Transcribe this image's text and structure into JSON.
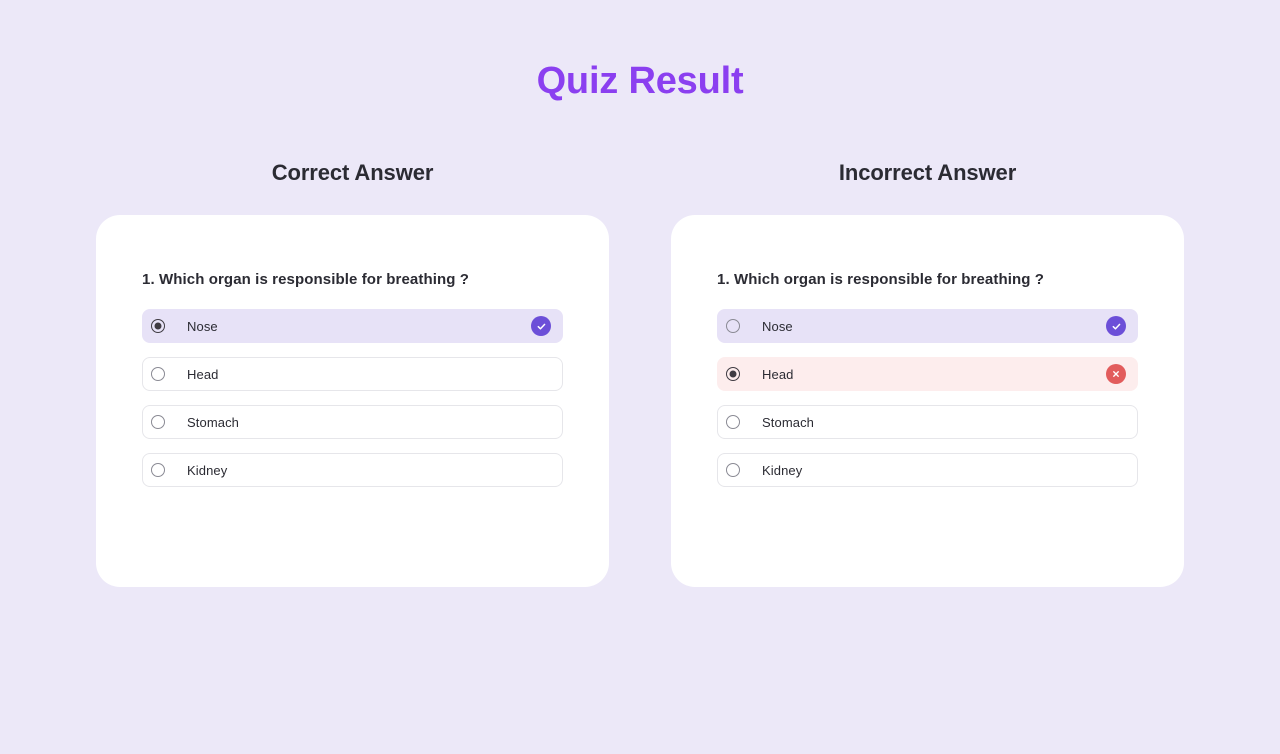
{
  "page": {
    "title": "Quiz Result",
    "title_color": "#8b3ff0",
    "background_color": "#ece8f8"
  },
  "colors": {
    "correct_badge": "#6c4fd8",
    "incorrect_badge": "#e25c5c",
    "correct_row_bg": "#e7e2f7",
    "incorrect_row_bg": "#fdeded",
    "card_bg": "#ffffff"
  },
  "columns": [
    {
      "heading": "Correct Answer",
      "card": {
        "question": "1. Which organ is responsible for breathing ?",
        "options": [
          {
            "label": "Nose",
            "selected": true,
            "state": "correct",
            "badge": "check-icon"
          },
          {
            "label": "Head",
            "selected": false,
            "state": "neutral",
            "badge": "none"
          },
          {
            "label": "Stomach",
            "selected": false,
            "state": "neutral",
            "badge": "none"
          },
          {
            "label": "Kidney",
            "selected": false,
            "state": "neutral",
            "badge": "none"
          }
        ]
      }
    },
    {
      "heading": "Incorrect Answer",
      "card": {
        "question": "1. Which organ is responsible for breathing ?",
        "options": [
          {
            "label": "Nose",
            "selected": false,
            "state": "correct",
            "badge": "check-icon"
          },
          {
            "label": "Head",
            "selected": true,
            "state": "incorrect",
            "badge": "cross-icon"
          },
          {
            "label": "Stomach",
            "selected": false,
            "state": "neutral",
            "badge": "none"
          },
          {
            "label": "Kidney",
            "selected": false,
            "state": "neutral",
            "badge": "none"
          }
        ]
      }
    }
  ]
}
